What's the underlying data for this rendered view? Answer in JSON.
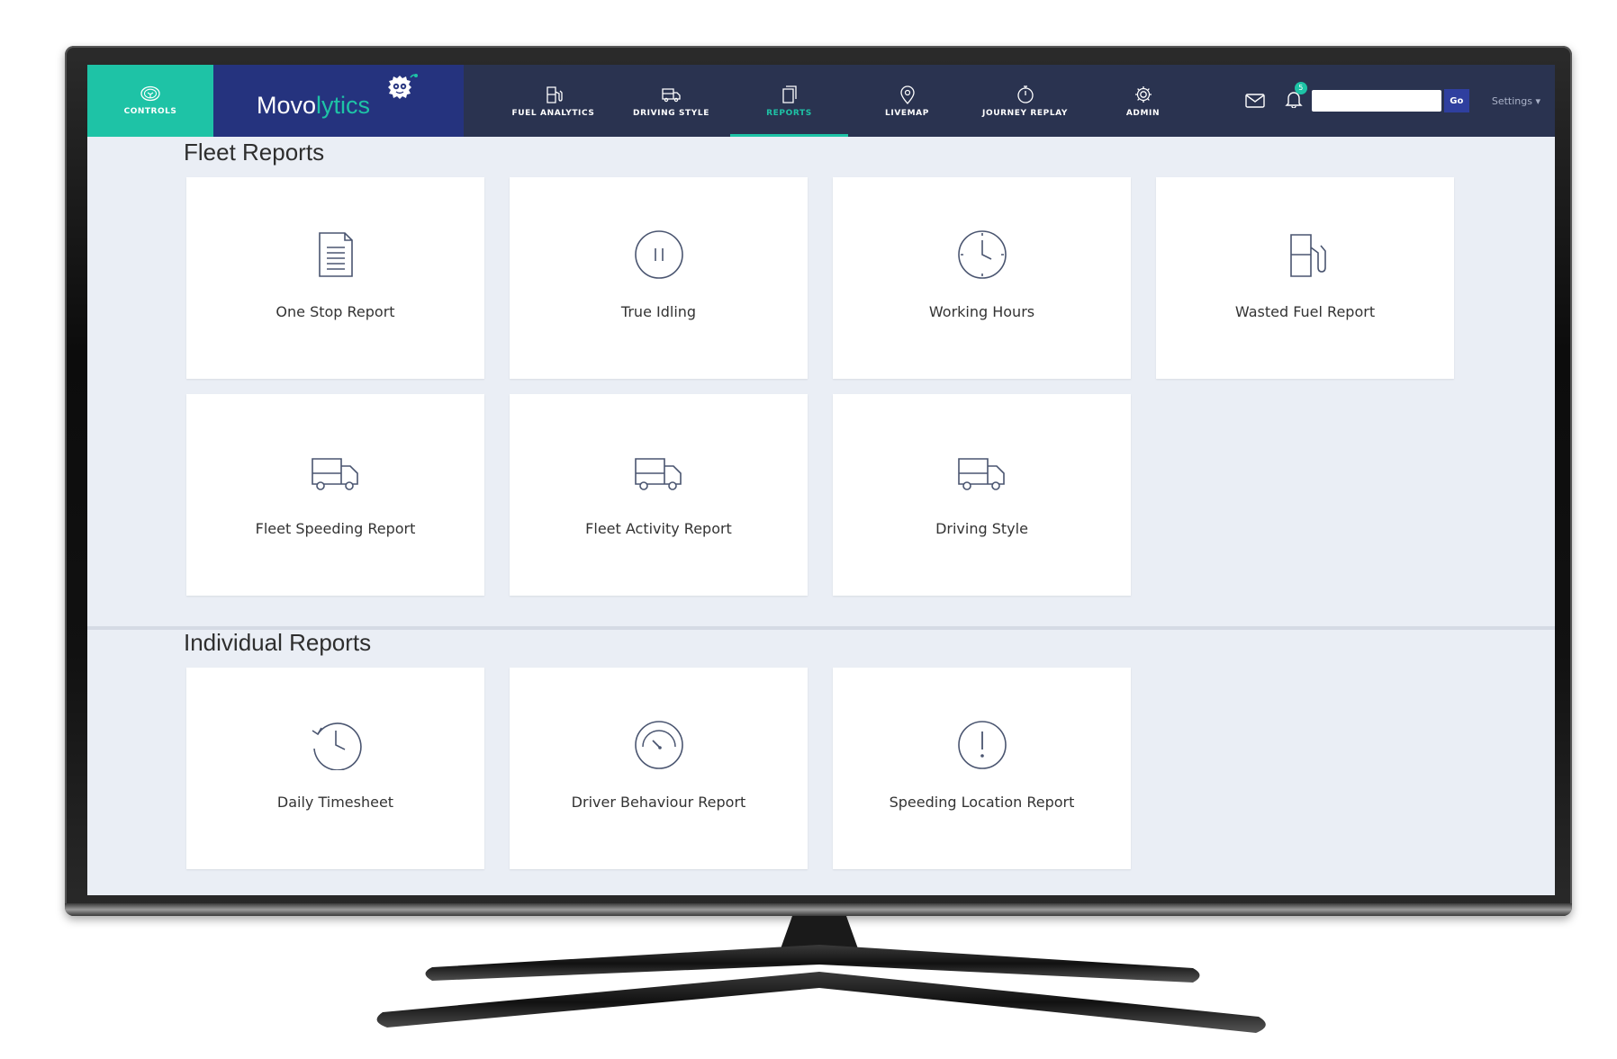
{
  "nav": {
    "controls_label": "CONTROLS",
    "brand_part1": "Movo",
    "brand_part2": "lytics",
    "items": [
      {
        "label": "FUEL ANALYTICS",
        "icon": "fuel-pump-icon"
      },
      {
        "label": "DRIVING STYLE",
        "icon": "truck-icon"
      },
      {
        "label": "REPORTS",
        "icon": "reports-icon",
        "active": true
      },
      {
        "label": "LIVEMAP",
        "icon": "map-pin-icon"
      },
      {
        "label": "JOURNEY REPLAY",
        "icon": "stopwatch-icon"
      },
      {
        "label": "ADMIN",
        "icon": "gear-icon"
      }
    ],
    "notification_count": "5",
    "search_value": "",
    "go_label": "Go",
    "settings_label": "Settings"
  },
  "fleet": {
    "title": "Fleet Reports",
    "cards": [
      {
        "label": "One Stop Report",
        "icon": "document-icon"
      },
      {
        "label": "True Idling",
        "icon": "pause-icon"
      },
      {
        "label": "Working Hours",
        "icon": "clock-icon"
      },
      {
        "label": "Wasted Fuel Report",
        "icon": "fuel-pump-icon"
      },
      {
        "label": "Fleet Speeding Report",
        "icon": "truck-icon"
      },
      {
        "label": "Fleet Activity Report",
        "icon": "truck-icon"
      },
      {
        "label": "Driving Style",
        "icon": "truck-icon"
      }
    ]
  },
  "individual": {
    "title": "Individual Reports",
    "cards": [
      {
        "label": "Daily Timesheet",
        "icon": "history-clock-icon"
      },
      {
        "label": "Driver Behaviour Report",
        "icon": "speedometer-icon"
      },
      {
        "label": "Speeding Location Report",
        "icon": "alert-icon"
      }
    ]
  },
  "colors": {
    "accent": "#1ec3a6",
    "nav_bg": "#2a3350",
    "brand_bg": "#25337e",
    "page_bg": "#eaeef5",
    "icon_stroke": "#4a5570"
  }
}
